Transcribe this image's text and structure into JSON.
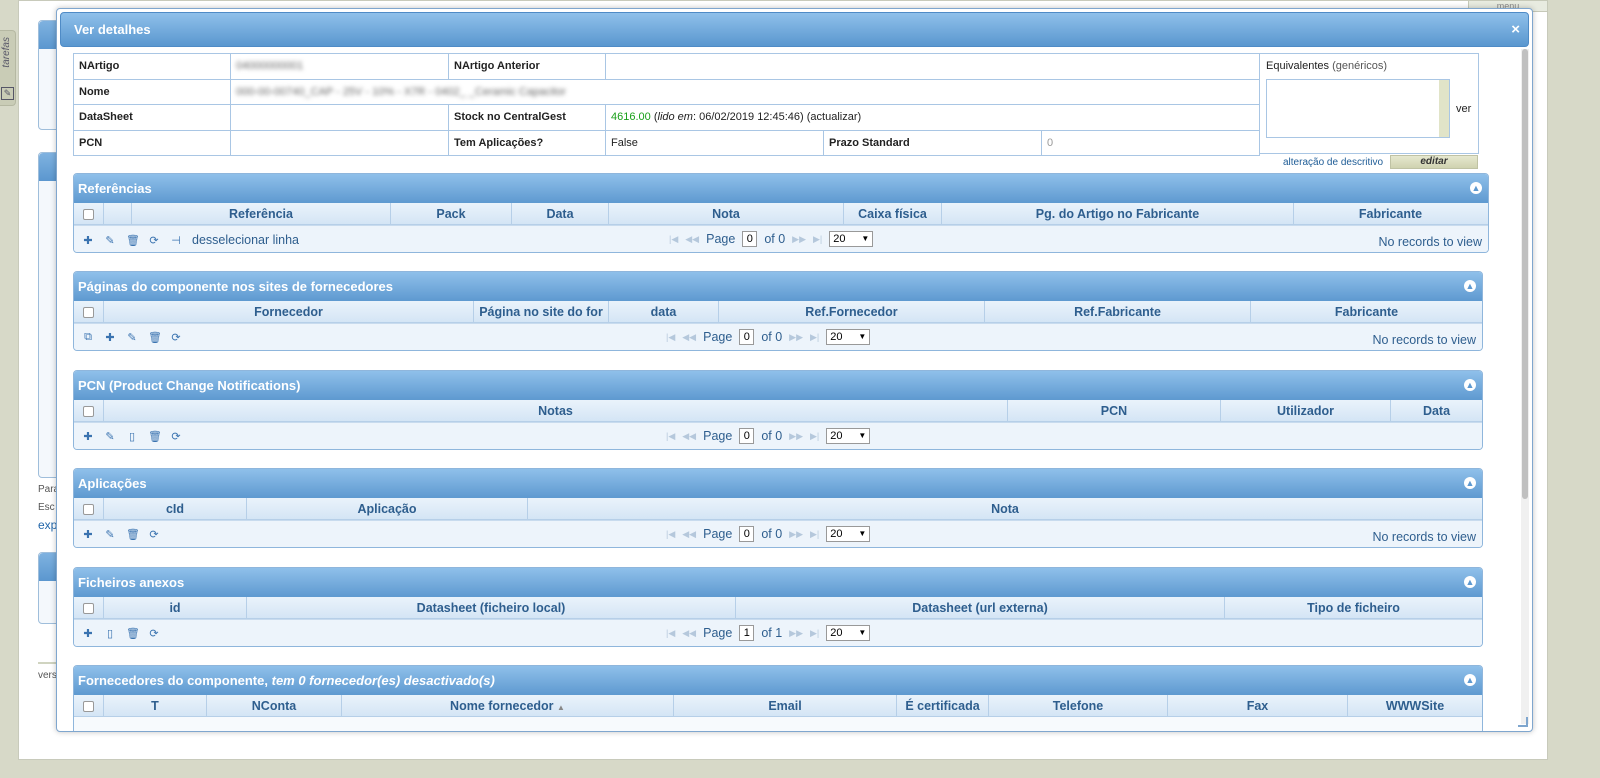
{
  "background": {
    "side_tab": "tarefas",
    "top_right": "menu",
    "texts": [
      "Para",
      "Esc",
      "exp",
      "vers"
    ]
  },
  "dialog": {
    "title": "Ver detalhes",
    "close": "×"
  },
  "info": {
    "nartigo_label": "NArtigo",
    "nartigo_value": "04000000001",
    "nartigo_anterior_label": "NArtigo Anterior",
    "nartigo_anterior_value": "",
    "nome_label": "Nome",
    "nome_value": "000-00-00740_CAP - 25V - 10% - X7R - 0402_ _Ceramic Capacitor",
    "datasheet_label": "DataSheet",
    "datasheet_value": "",
    "stock_label": "Stock no CentralGest",
    "stock_value": "4616.00",
    "stock_lido_prefix": "(",
    "stock_lido_label": "lido em",
    "stock_lido_date": ": 06/02/2019 12:45:46)",
    "stock_actualizar": "(actualizar)",
    "pcn_label": "PCN",
    "pcn_value": "",
    "tem_aplicacoes_label": "Tem Aplicações?",
    "tem_aplicacoes_value": "False",
    "prazo_label": "Prazo Standard",
    "prazo_value": "0",
    "equivalentes_label": "Equivalentes",
    "equivalentes_sub": "(genéricos)",
    "ver": "ver",
    "desc_link": "alteração de descritivo",
    "editar": "editar"
  },
  "grids": {
    "referencias": {
      "title": "Referências",
      "cols": [
        "Referência",
        "Pack",
        "Data",
        "Nota",
        "Caixa física",
        "Pg. do Artigo no Fabricante",
        "Fabricante"
      ],
      "deselect": "desselecionar linha",
      "page_label": "Page",
      "page": "0",
      "of": "of 0",
      "rows": "20",
      "no_records": "No records to view"
    },
    "paginas": {
      "title": "Páginas do componente nos sites de fornecedores",
      "cols": [
        "Fornecedor",
        "Página no site do for",
        "data",
        "Ref.Fornecedor",
        "Ref.Fabricante",
        "Fabricante"
      ],
      "page_label": "Page",
      "page": "0",
      "of": "of 0",
      "rows": "20",
      "no_records": "No records to view"
    },
    "pcn": {
      "title": "PCN (Product Change Notifications)",
      "cols": [
        "Notas",
        "PCN",
        "Utilizador",
        "Data"
      ],
      "page_label": "Page",
      "page": "0",
      "of": "of 0",
      "rows": "20"
    },
    "aplicacoes": {
      "title": "Aplicações",
      "cols": [
        "cId",
        "Aplicação",
        "Nota"
      ],
      "page_label": "Page",
      "page": "0",
      "of": "of 0",
      "rows": "20",
      "no_records": "No records to view"
    },
    "ficheiros": {
      "title": "Ficheiros anexos",
      "cols": [
        "id",
        "Datasheet (ficheiro local)",
        "Datasheet (url externa)",
        "Tipo de ficheiro"
      ],
      "page_label": "Page",
      "page": "1",
      "of": "of 1",
      "rows": "20"
    },
    "fornecedores": {
      "title": "Fornecedores do componente,",
      "title_italic": "tem 0 fornecedor(es) desactivado(s)",
      "cols": [
        "T",
        "NConta",
        "Nome fornecedor",
        "Email",
        "É certificada",
        "Telefone",
        "Fax",
        "WWWSite"
      ]
    }
  },
  "colors": {
    "header_top": "#8fc0ea",
    "header_bottom": "#5e99d0",
    "column_text": "#2e5e8e",
    "stock_green": "#1aa01a"
  }
}
